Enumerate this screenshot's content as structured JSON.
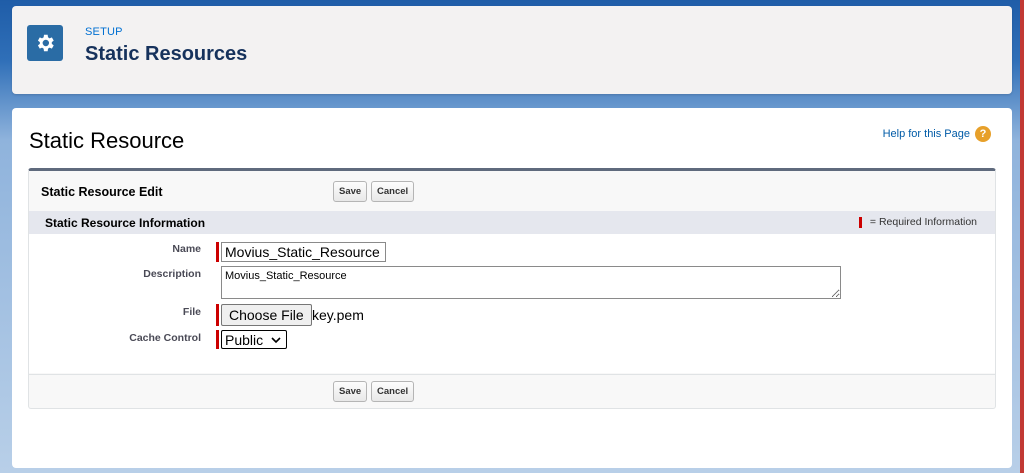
{
  "header": {
    "eyebrow": "SETUP",
    "title": "Static Resources",
    "icon": "gear-icon"
  },
  "page": {
    "title": "Static Resource",
    "help_label": "Help for this Page",
    "help_icon": "?"
  },
  "panel": {
    "title": "Static Resource Edit",
    "save_label": "Save",
    "cancel_label": "Cancel"
  },
  "section": {
    "title": "Static Resource Information",
    "required_legend": "= Required Information"
  },
  "form": {
    "name_label": "Name",
    "name_value": "Movius_Static_Resource",
    "description_label": "Description",
    "description_value": "Movius_Static_Resource",
    "file_label": "File",
    "file_button": "Choose File",
    "file_name": "key.pem",
    "cache_label": "Cache Control",
    "cache_value": "Public"
  },
  "colors": {
    "accent": "#0070d2",
    "required": "#cc0000",
    "header_icon_bg": "#2a6ca5",
    "help_icon_bg": "#e7a02a"
  }
}
